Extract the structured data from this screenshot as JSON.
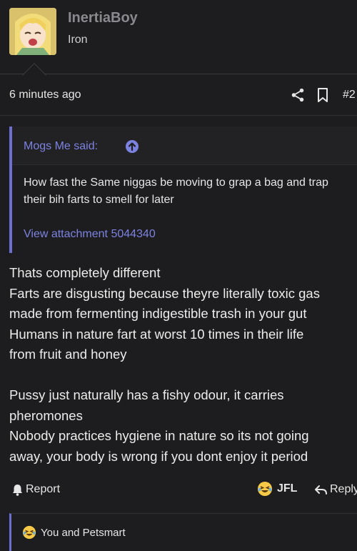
{
  "author": {
    "username": "InertiaBoy",
    "rank": "Iron"
  },
  "post": {
    "time": "6 minutes ago",
    "number": "#2",
    "icons": [
      "share-icon",
      "bookmark-icon"
    ]
  },
  "quote": {
    "author_said": "Mogs Me said:",
    "text": "How fast the Same niggas be moving to grap a bag and trap their bih farts to smell for later",
    "attachment_link": "View attachment 5044340"
  },
  "body": {
    "lines": [
      "Thats completely different",
      "Farts are disgusting because theyre literally toxic gas",
      "made from fermenting indigestible trash in your gut",
      "Humans in nature fart at worst 10 times in their life",
      "from fruit and honey",
      "",
      "Pussy just naturally has a fishy odour, it carries",
      "pheromones",
      "Nobody practices hygiene in nature so its not going",
      "away, your body is wrong if you dont enjoy it period"
    ]
  },
  "actions": {
    "report_label": "Report",
    "jfl_label": "JFL",
    "reply_label": "Reply"
  },
  "reactions": {
    "summary": "You and Petsmart"
  },
  "colors": {
    "background": "#1d1d1f",
    "accent": "#6a6fd0",
    "link": "#7c82e0",
    "username": "#8a8a8e"
  }
}
